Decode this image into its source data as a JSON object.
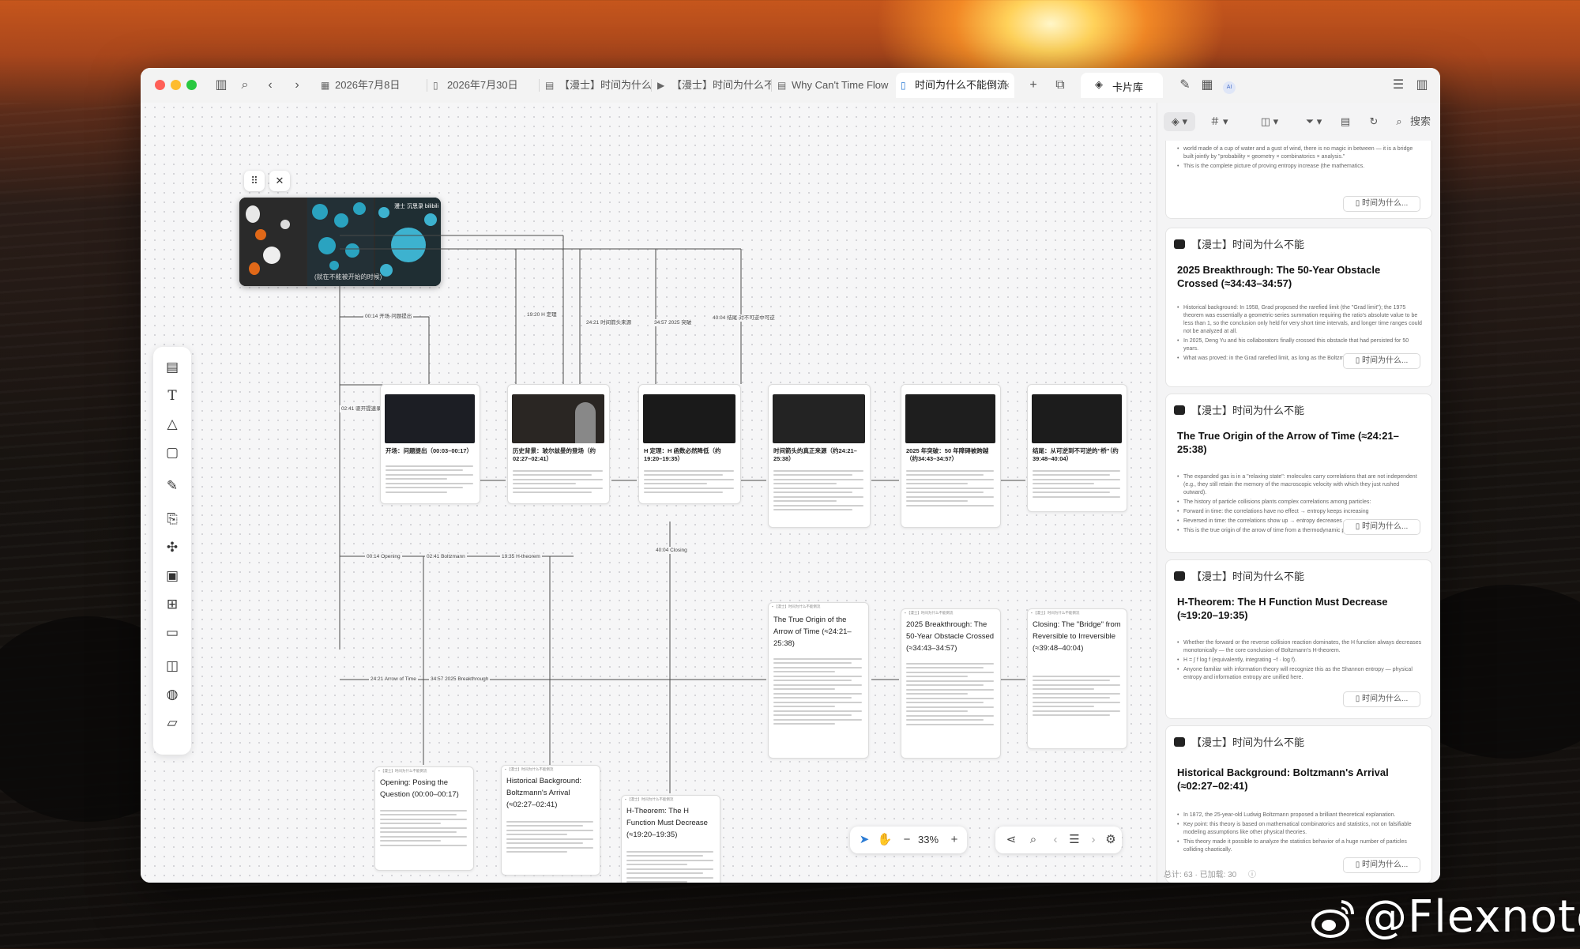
{
  "watermark": "@Flexnote",
  "tabs": [
    {
      "label": "2026年7月8日",
      "icon": "calendar-icon"
    },
    {
      "label": "2026年7月30日",
      "icon": "book-icon"
    },
    {
      "label": "【漫士】时间为什么不...",
      "icon": "document-icon"
    },
    {
      "label": "【漫士】时间为什么不...",
      "icon": "video-icon"
    },
    {
      "label": "Why Can't Time Flow ...",
      "icon": "document-icon"
    },
    {
      "label": "时间为什么不能倒流",
      "icon": "book-icon",
      "active": true
    }
  ],
  "titlebar": {
    "card_library": "卡片库",
    "ai_badge": "AI"
  },
  "video": {
    "brand": "漫士 沉思录 bilibili",
    "caption": "(就在不能被开始的时候)"
  },
  "edge_labels": [
    "00:14 开场·问题提出",
    "19:20 H 定理",
    "24:21 时间箭头来源",
    "34:57 2025 突破",
    "40:04 结尾·对不可逆中可逆",
    "02:41 驱开提速录",
    "00:14 Opening",
    "02:41 Boltzmann",
    "19:35 H-theorem",
    "40:04 Closing",
    "24:21 Arrow of Time",
    "34:57 2025 Breakthrough"
  ],
  "cards_top": [
    {
      "title": "开场：问题提出（00:03–00:17）"
    },
    {
      "title": "历史背景：玻尔兹曼的登场（约02:27–02:41）"
    },
    {
      "title": "H 定理：H 函数必然降低（约19:20–19:35）"
    },
    {
      "title": "时间箭头的真正来源（约24:21–25:38）"
    },
    {
      "title": "2025 年突破：50 年障碍被跨越（约34:43–34:57）"
    },
    {
      "title": "结尾：从可逆到不可逆的“桥”（约39:48–40:04）"
    }
  ],
  "cards_mid": [
    {
      "title": "The True Origin of the Arrow of Time (≈24:21–25:38)"
    },
    {
      "title": "2025 Breakthrough: The 50-Year Obstacle Crossed (≈34:43–34:57)"
    },
    {
      "title": "Closing: The \"Bridge\" from Reversible to Irreversible (≈39:48–40:04)"
    }
  ],
  "cards_low": [
    {
      "title": "Opening: Posing the Question (00:00–00:17)"
    },
    {
      "title": "Historical Background: Boltzmann's Arrival (≈02:27–02:41)"
    },
    {
      "title": "H-Theorem: The H Function Must Decrease (≈19:20–19:35)"
    }
  ],
  "zoom": "33%",
  "panel": {
    "search_placeholder": "搜索",
    "top_snippet": [
      "world made of a cup of water and a gust of wind, there is no magic in between — it is a bridge built jointly by \"probability × geometry × combinatorics × analysis.\"",
      "This is the complete picture of proving entropy increase (the mathematics."
    ],
    "link_label": "时间为什么...",
    "cards": [
      {
        "source": "【漫士】时间为什么不能",
        "title": "2025 Breakthrough: The 50-Year Obstacle Crossed (≈34:43–34:57)",
        "body": [
          "Historical background: In 1958, Grad proposed the rarefied limit (the \"Grad limit\"); the 1975 theorem was essentially a geometric-series summation requiring the ratio's absolute value to be less than 1, so the conclusion only held for very short time intervals, and longer time ranges could not be analyzed at all.",
          "In 2025, Deng Yu and his collaborators finally crossed this obstacle that had persisted for 50 years.",
          "What was proved: in the Grad rarefied limit, as long as the Boltzmann equation"
        ]
      },
      {
        "source": "【漫士】时间为什么不能",
        "title": "The True Origin of the Arrow of Time (≈24:21–25:38)",
        "body": [
          "The expanded gas is in a \"relaxing state\": molecules carry correlations that are not independent (e.g., they still retain the memory of the macroscopic velocity with which they just rushed outward).",
          "The history of particle collisions plants complex correlations among particles:",
          "Forward in time: the correlations have no effect → entropy keeps increasing",
          "Reversed in time: the correlations show up → entropy decreases",
          "This is the true origin of the arrow of time from a thermodynamic perspective."
        ]
      },
      {
        "source": "【漫士】时间为什么不能",
        "title": "H-Theorem: The H Function Must Decrease (≈19:20–19:35)",
        "body": [
          "Whether the forward or the reverse collision reaction dominates, the H function always decreases monotonically — the core conclusion of Boltzmann's H-theorem.",
          "H = ∫ f log f (equivalently, integrating −f · log f).",
          "Anyone familiar with information theory will recognize this as the Shannon entropy — physical entropy and information entropy are unified here."
        ]
      },
      {
        "source": "【漫士】时间为什么不能",
        "title": "Historical Background: Boltzmann's Arrival (≈02:27–02:41)",
        "body": [
          "In 1872, the 25-year-old Ludwig Boltzmann proposed a brilliant theoretical explanation.",
          "Key point: this theory is based on mathematical combinatorics and statistics, not on falsifiable modeling assumptions like other physical theories.",
          "This theory made it possible to analyze the statistics behavior of a huge number of particles colliding chaotically."
        ]
      }
    ],
    "status": "总计: 63 · 已加载: 30"
  }
}
